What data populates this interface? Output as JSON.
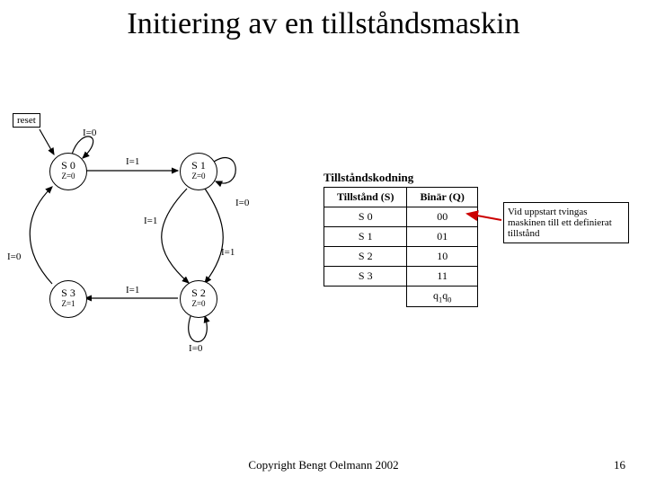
{
  "title": "Initiering av en tillståndsmaskin",
  "reset_label": "reset",
  "states": {
    "s0": {
      "name": "S 0",
      "z": "Z=0"
    },
    "s1": {
      "name": "S 1",
      "z": "Z=0"
    },
    "s2": {
      "name": "S 2",
      "z": "Z=0"
    },
    "s3": {
      "name": "S 3",
      "z": "Z=1"
    }
  },
  "edge_labels": {
    "loop_s0": "I=0",
    "s0_s1": "I=1",
    "loop_s1": "I=0",
    "s1_s2_a": "I=1",
    "s1_s2_b": "I=1",
    "s3_s0": "I=0",
    "s2_s3": "I=1",
    "loop_s2": "I=0"
  },
  "encoding": {
    "caption": "Tillståndskodning",
    "head_state": "Tillstånd (S)",
    "head_bin": "Binär (Q)",
    "rows": [
      {
        "s": "S 0",
        "q": "00"
      },
      {
        "s": "S 1",
        "q": "01"
      },
      {
        "s": "S 2",
        "q": "10"
      },
      {
        "s": "S 3",
        "q": "11"
      }
    ],
    "foot": "q",
    "foot_sub1": "1",
    "foot_sub0": "0"
  },
  "callout": "Vid uppstart tvingas maskinen till ett definierat tillstånd",
  "copyright": "Copyright Bengt Oelmann 2002",
  "page": "16",
  "chart_data": {
    "type": "state_diagram",
    "title": "Initiering av en tillståndsmaskin",
    "states": [
      {
        "id": "S0",
        "output": "Z=0"
      },
      {
        "id": "S1",
        "output": "Z=0"
      },
      {
        "id": "S2",
        "output": "Z=0"
      },
      {
        "id": "S3",
        "output": "Z=1"
      }
    ],
    "transitions": [
      {
        "from": "reset",
        "to": "S0",
        "label": ""
      },
      {
        "from": "S0",
        "to": "S0",
        "label": "I=0"
      },
      {
        "from": "S0",
        "to": "S1",
        "label": "I=1"
      },
      {
        "from": "S1",
        "to": "S1",
        "label": "I=0"
      },
      {
        "from": "S1",
        "to": "S2",
        "label": "I=1"
      },
      {
        "from": "S2",
        "to": "S2",
        "label": "I=0"
      },
      {
        "from": "S2",
        "to": "S3",
        "label": "I=1"
      },
      {
        "from": "S3",
        "to": "S0",
        "label": "I=0"
      }
    ],
    "encoding_table": [
      {
        "state": "S0",
        "binary": "00"
      },
      {
        "state": "S1",
        "binary": "01"
      },
      {
        "state": "S2",
        "binary": "10"
      },
      {
        "state": "S3",
        "binary": "11"
      }
    ],
    "annotation": "Vid uppstart tvingas maskinen till ett definierat tillstånd"
  }
}
